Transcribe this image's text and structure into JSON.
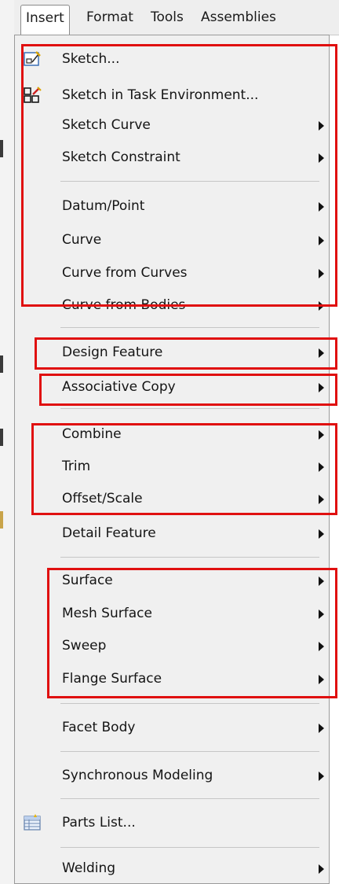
{
  "menubar": {
    "items": [
      {
        "label": "Insert",
        "active": true
      },
      {
        "label": "Format"
      },
      {
        "label": "Tools"
      },
      {
        "label": "Assemblies"
      }
    ]
  },
  "menu": {
    "items": [
      {
        "label": "Sketch...",
        "icon": "sketch-icon"
      },
      {
        "label": "Sketch in Task Environment...",
        "icon": "sketch-task-environment-icon"
      },
      {
        "label": "Sketch Curve",
        "submenu": true
      },
      {
        "label": "Sketch Constraint",
        "submenu": true
      },
      {
        "label": "Datum/Point",
        "submenu": true
      },
      {
        "label": "Curve",
        "submenu": true
      },
      {
        "label": "Curve from Curves",
        "submenu": true
      },
      {
        "label": "Curve from Bodies",
        "submenu": true
      },
      {
        "label": "Design Feature",
        "submenu": true
      },
      {
        "label": "Associative Copy",
        "submenu": true
      },
      {
        "label": "Combine",
        "submenu": true
      },
      {
        "label": "Trim",
        "submenu": true
      },
      {
        "label": "Offset/Scale",
        "submenu": true
      },
      {
        "label": "Detail Feature",
        "submenu": true
      },
      {
        "label": "Surface",
        "submenu": true
      },
      {
        "label": "Mesh Surface",
        "submenu": true
      },
      {
        "label": "Sweep",
        "submenu": true
      },
      {
        "label": "Flange Surface",
        "submenu": true
      },
      {
        "label": "Facet Body",
        "submenu": true
      },
      {
        "label": "Synchronous Modeling",
        "submenu": true
      },
      {
        "label": "Parts List...",
        "icon": "parts-list-icon"
      },
      {
        "label": "Welding",
        "submenu": true
      }
    ]
  },
  "colors": {
    "highlight_box": "#e01010",
    "menu_background": "#f0f0f0"
  }
}
